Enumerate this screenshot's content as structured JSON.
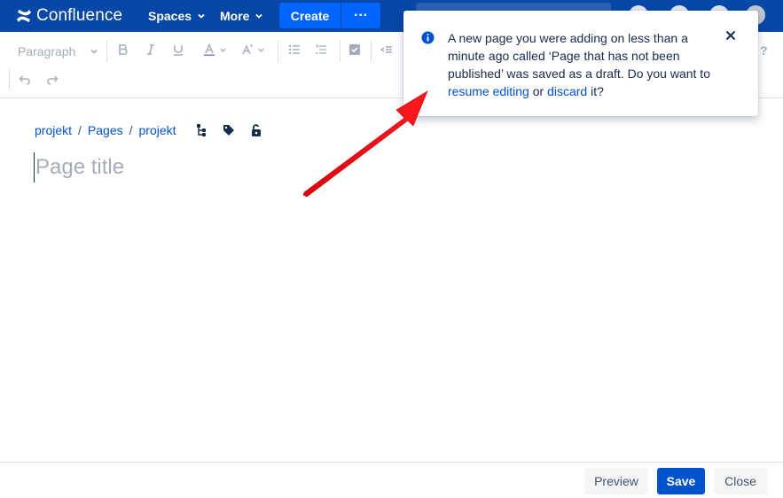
{
  "header": {
    "brand": "Confluence",
    "nav": [
      {
        "label": "Spaces"
      },
      {
        "label": "More"
      }
    ],
    "create_label": "Create",
    "more_actions_label": "···"
  },
  "toolbar": {
    "paragraph_label": "Paragraph",
    "help_label": "?"
  },
  "breadcrumb": {
    "items": [
      "projekt",
      "Pages",
      "projekt"
    ],
    "separator": "/"
  },
  "editor": {
    "title_placeholder": "Page title"
  },
  "footer": {
    "preview_label": "Preview",
    "save_label": "Save",
    "close_label": "Close"
  },
  "notification": {
    "text_before": "A new page you were adding on less than a minute ago called ‘Page that has not been published’ was saved as a draft. Do you want to ",
    "resume_link": "resume editing",
    "text_or": " or ",
    "discard_link": "discard",
    "text_after": " it?"
  },
  "colors": {
    "header_bg": "#0747a6",
    "create_bg": "#0065ff",
    "link": "#0052cc",
    "save_bg": "#0052cc",
    "annotation_arrow": "#e8151b"
  }
}
